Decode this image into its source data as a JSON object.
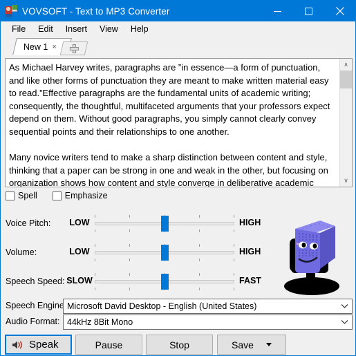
{
  "window": {
    "title": "VOVSOFT - Text to MP3 Converter",
    "icon": "app-icon",
    "titlebar_color": "#0078d7",
    "controls": {
      "minimize": "minimize-icon",
      "maximize": "maximize-icon",
      "close": "close-icon"
    }
  },
  "menu": {
    "items": [
      {
        "label": "File"
      },
      {
        "label": "Edit"
      },
      {
        "label": "Insert"
      },
      {
        "label": "View"
      },
      {
        "label": "Help"
      }
    ]
  },
  "tabs": {
    "items": [
      {
        "label": "New 1",
        "close": "×",
        "active": true
      }
    ],
    "new_tab": "add-tab-icon"
  },
  "editor": {
    "text": "As Michael Harvey writes, paragraphs are ”in essence—a form of punctuation, and like other forms of punctuation they are meant to make written material easy to read.”Effective paragraphs are the fundamental units of academic writing; consequently, the thoughtful, multifaceted arguments that your professors expect depend on them. Without good paragraphs, you simply cannot clearly convey sequential points and their relationships to one another.\n\nMany novice writers tend to make a sharp distinction between content and style, thinking that a paper can be strong in one and weak in the other, but focusing on organization shows how content and style converge in deliberative academic writing. Your professors will view even the most elegant prose as rambling and",
    "scrollbar": {
      "up_arrow": "∧",
      "down_arrow": "∨"
    }
  },
  "options": {
    "spell": {
      "label": "Spell",
      "checked": false
    },
    "emphasize": {
      "label": "Emphasize",
      "checked": false
    }
  },
  "sliders": [
    {
      "label": "Voice Pitch:",
      "min_label": "LOW",
      "max_label": "HIGH",
      "value": 50,
      "ticks": 5
    },
    {
      "label": "Volume:",
      "min_label": "LOW",
      "max_label": "HIGH",
      "value": 50,
      "ticks": 5
    },
    {
      "label": "Speech Speed:",
      "min_label": "SLOW",
      "max_label": "FAST",
      "value": 50,
      "ticks": 5
    }
  ],
  "mascot": {
    "name": "microphone-mascot",
    "body_color": "#6f6ae0",
    "body_shade": "#5954c4",
    "highlight_color": "#8d89ee",
    "stand_color": "#000000"
  },
  "combos": [
    {
      "label": "Speech Engine:",
      "value": "Microsoft David Desktop - English (United States)",
      "arrow": "chevron-down-icon"
    },
    {
      "label": "Audio Format:",
      "value": "44kHz 8Bit Mono",
      "arrow": "chevron-down-icon"
    }
  ],
  "buttons": {
    "speak": {
      "label": "Speak",
      "icon": "speaker-icon",
      "focused": true
    },
    "pause": {
      "label": "Pause"
    },
    "stop": {
      "label": "Stop"
    },
    "save": {
      "label": "Save",
      "arrow": "caret-down-icon"
    }
  },
  "colors": {
    "accent": "#0078d7",
    "window_bg": "#f0f0f0",
    "field_bg": "#ffffff",
    "button_bg": "#e1e1e1",
    "speaker_wave": "#c0392b"
  }
}
